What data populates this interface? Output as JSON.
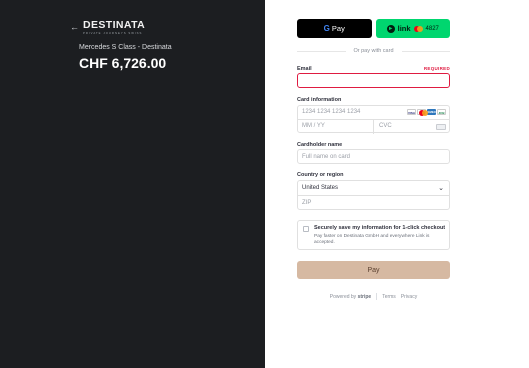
{
  "summary": {
    "back_icon": "arrow-left-icon",
    "brand_name": "DESTINATA",
    "brand_tagline": "PRIVATE JOURNEYS SWISS",
    "product_name": "Mercedes S Class - Destinata",
    "amount": "CHF 6,726.00"
  },
  "express": {
    "gpay_icon": "G",
    "gpay_label": "Pay",
    "link_label": "link",
    "link_card_digits": "4827"
  },
  "divider_text": "Or pay with card",
  "form": {
    "email_label": "Email",
    "email_required": "REQUIRED",
    "email_value": "",
    "card_label": "Card information",
    "card_number_placeholder": "1234 1234 1234 1234",
    "card_brands": [
      "VISA",
      "MC",
      "AMEX",
      "JCB"
    ],
    "expiry_placeholder": "MM / YY",
    "cvc_placeholder": "CVC",
    "name_label": "Cardholder name",
    "name_placeholder": "Full name on card",
    "country_label": "Country or region",
    "country_value": "United States",
    "zip_placeholder": "ZIP",
    "save_title": "Securely save my information for 1-click checkout",
    "save_desc": "Pay faster on Destinata GmbH and everywhere Link is accepted.",
    "pay_label": "Pay"
  },
  "footer": {
    "powered_by": "Powered by",
    "stripe": "stripe",
    "terms": "Terms",
    "privacy": "Privacy"
  },
  "colors": {
    "left_bg": "#1c1e21",
    "gpay_bg": "#000000",
    "link_bg": "#00d66f",
    "error": "#df1b41",
    "pay_button": "#d6b9a2"
  }
}
